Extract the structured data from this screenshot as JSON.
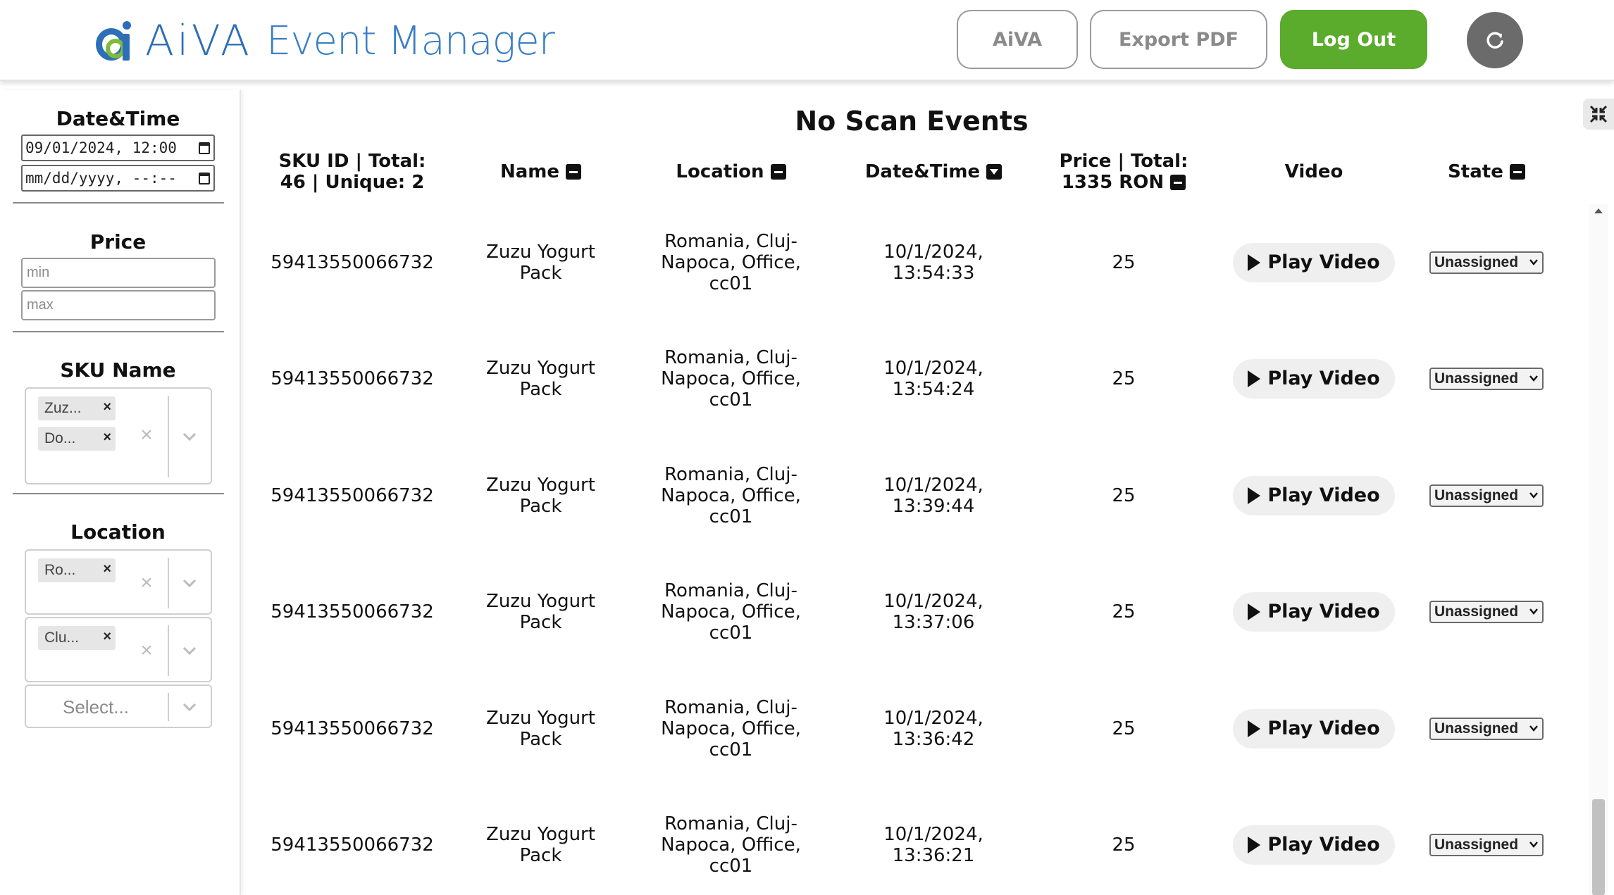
{
  "header": {
    "brand": "AiVA",
    "app_title": "Event Manager",
    "buttons": {
      "aiva": "AiVA",
      "export_pdf": "Export PDF",
      "log_out": "Log Out"
    },
    "colors": {
      "brand_blue": "#2d6fb6",
      "logout_green": "#5bab2c",
      "refresh_gray": "#6b6b6b"
    },
    "refresh_icon": "refresh-icon"
  },
  "sidebar": {
    "datetime": {
      "title": "Date&Time",
      "from_value": "09/01/2024, 12:00",
      "to_value": "mm/dd/yyyy, --:--"
    },
    "price": {
      "title": "Price",
      "min_placeholder": "min",
      "max_placeholder": "max"
    },
    "sku_name": {
      "title": "SKU Name",
      "chips": [
        "Zuz...",
        "Do..."
      ]
    },
    "location": {
      "title": "Location",
      "chip_country": "Ro...",
      "chip_city": "Clu...",
      "select_placeholder": "Select..."
    }
  },
  "main": {
    "title": "No Scan Events",
    "columns": {
      "sku": "SKU ID | Total: 46 | Unique: 2",
      "name": "Name",
      "location": "Location",
      "datetime": "Date&Time",
      "price": "Price | Total: 1335 RON",
      "video": "Video",
      "state": "State"
    },
    "play_label": "Play Video",
    "rows": [
      {
        "sku": "59413550066732",
        "name": "Zuzu Yogurt Pack",
        "location": "Romania, Cluj-Napoca, Office, cc01",
        "datetime": "10/1/2024, 13:54:33",
        "price": "25",
        "state": "Unassigned"
      },
      {
        "sku": "59413550066732",
        "name": "Zuzu Yogurt Pack",
        "location": "Romania, Cluj-Napoca, Office, cc01",
        "datetime": "10/1/2024, 13:54:24",
        "price": "25",
        "state": "Unassigned"
      },
      {
        "sku": "59413550066732",
        "name": "Zuzu Yogurt Pack",
        "location": "Romania, Cluj-Napoca, Office, cc01",
        "datetime": "10/1/2024, 13:39:44",
        "price": "25",
        "state": "Unassigned"
      },
      {
        "sku": "59413550066732",
        "name": "Zuzu Yogurt Pack",
        "location": "Romania, Cluj-Napoca, Office, cc01",
        "datetime": "10/1/2024, 13:37:06",
        "price": "25",
        "state": "Unassigned"
      },
      {
        "sku": "59413550066732",
        "name": "Zuzu Yogurt Pack",
        "location": "Romania, Cluj-Napoca, Office, cc01",
        "datetime": "10/1/2024, 13:36:42",
        "price": "25",
        "state": "Unassigned"
      },
      {
        "sku": "59413550066732",
        "name": "Zuzu Yogurt Pack",
        "location": "Romania, Cluj-Napoca, Office, cc01",
        "datetime": "10/1/2024, 13:36:21",
        "price": "25",
        "state": "Unassigned"
      }
    ]
  }
}
